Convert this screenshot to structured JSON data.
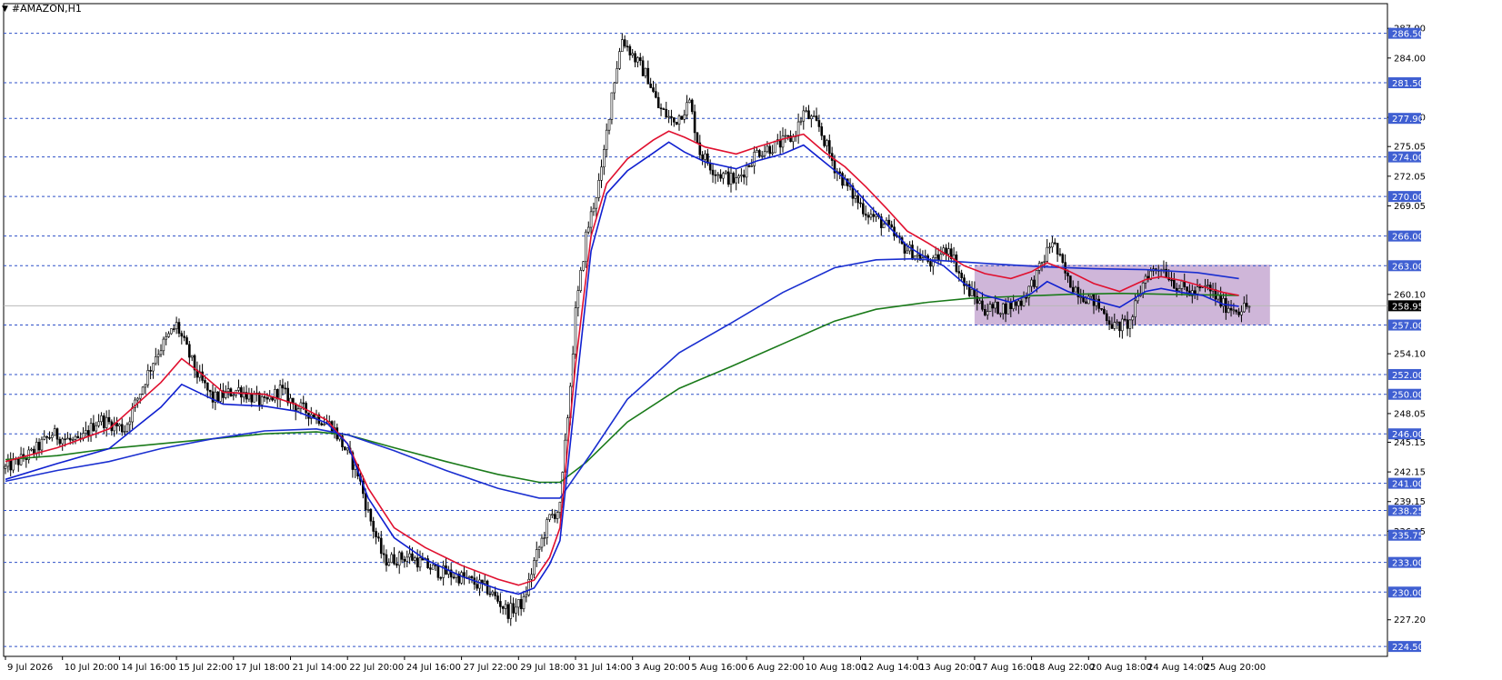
{
  "window": {
    "title": "#AMAZON,H1",
    "menu_icon": "triangle-down-icon"
  },
  "colors": {
    "level_line": "#2f50c8",
    "level_label_bg": "#3f5fd2",
    "ema_fast": "#e0102f",
    "ema_mid": "#1020d0",
    "ema_slow_blue": "#1a2fd0",
    "sma_green": "#1a7a1a",
    "range_box": "#c7a9d2",
    "price_tag_bg": "#000000"
  },
  "chart_data": {
    "type": "candlestick",
    "symbol": "#AMAZON",
    "timeframe": "H1",
    "ylim": [
      223.5,
      289.5
    ],
    "y_ticks": [
      "287.00",
      "284.00",
      "281.50",
      "278.00",
      "275.05",
      "272.05",
      "269.05",
      "266.00",
      "263.00",
      "260.10",
      "257.00",
      "254.10",
      "252.00",
      "250.00",
      "248.05",
      "246.00",
      "245.15",
      "242.15",
      "241.00",
      "239.15",
      "238.25",
      "236.15",
      "235.75",
      "233.00",
      "230.00",
      "227.20",
      "224.50"
    ],
    "levels": [
      286.5,
      281.5,
      277.9,
      274.0,
      270.0,
      266.0,
      263.0,
      257.0,
      252.0,
      250.0,
      246.0,
      241.0,
      238.25,
      235.75,
      233.0,
      230.0,
      224.5
    ],
    "level_labels": [
      "286.50",
      "281.50",
      "277.90",
      "274.00",
      "270.00",
      "266.00",
      "263.00",
      "257.00",
      "252.00",
      "250.00",
      "246.00",
      "241.00",
      "238.25",
      "235.75",
      "233.00",
      "230.00",
      "224.50"
    ],
    "current_price": 258.95,
    "current_price_label": "258.95",
    "x_labels": [
      "9 Jul 2026",
      "10 Jul 20:00",
      "14 Jul 16:00",
      "15 Jul 22:00",
      "17 Jul 18:00",
      "21 Jul 14:00",
      "22 Jul 20:00",
      "24 Jul 16:00",
      "27 Jul 22:00",
      "29 Jul 18:00",
      "31 Jul 14:00",
      "3 Aug 20:00",
      "5 Aug 16:00",
      "6 Aug 22:00",
      "10 Aug 18:00",
      "12 Aug 14:00",
      "13 Aug 20:00",
      "17 Aug 16:00",
      "18 Aug 22:00",
      "20 Aug 18:00",
      "24 Aug 14:00",
      "25 Aug 20:00"
    ],
    "x_label_index": [
      0,
      22,
      44,
      66,
      88,
      110,
      132,
      154,
      176,
      198,
      220,
      242,
      264,
      286,
      308,
      330,
      352,
      374,
      396,
      418,
      440,
      462
    ],
    "bar_count": 480,
    "path": [
      [
        0,
        242.5
      ],
      [
        10,
        244
      ],
      [
        18,
        246
      ],
      [
        28,
        245
      ],
      [
        36,
        247.5
      ],
      [
        46,
        246.5
      ],
      [
        58,
        254
      ],
      [
        66,
        257
      ],
      [
        74,
        252
      ],
      [
        80,
        249.5
      ],
      [
        90,
        250.5
      ],
      [
        100,
        249
      ],
      [
        106,
        250.5
      ],
      [
        112,
        248.8
      ],
      [
        120,
        247.8
      ],
      [
        126,
        246.8
      ],
      [
        132,
        244
      ],
      [
        136,
        242
      ],
      [
        140,
        238
      ],
      [
        146,
        233.2
      ],
      [
        156,
        233.6
      ],
      [
        166,
        232.2
      ],
      [
        176,
        231.5
      ],
      [
        186,
        230.3
      ],
      [
        194,
        228
      ],
      [
        200,
        229
      ],
      [
        204,
        233
      ],
      [
        210,
        237.5
      ],
      [
        214,
        238.5
      ],
      [
        218,
        251
      ],
      [
        220,
        258.2
      ],
      [
        222,
        262
      ],
      [
        224,
        266
      ],
      [
        230,
        272.4
      ],
      [
        234,
        280.5
      ],
      [
        238,
        286
      ],
      [
        244,
        283.5
      ],
      [
        248,
        282
      ],
      [
        252,
        279
      ],
      [
        258,
        277.5
      ],
      [
        264,
        279.5
      ],
      [
        268,
        274.5
      ],
      [
        274,
        272.5
      ],
      [
        282,
        271.5
      ],
      [
        290,
        274.5
      ],
      [
        298,
        275.2
      ],
      [
        304,
        276
      ],
      [
        308,
        278.5
      ],
      [
        314,
        277
      ],
      [
        320,
        273
      ],
      [
        326,
        270.5
      ],
      [
        332,
        268.5
      ],
      [
        340,
        267
      ],
      [
        346,
        265
      ],
      [
        352,
        264
      ],
      [
        358,
        263.2
      ],
      [
        364,
        265
      ],
      [
        370,
        261
      ],
      [
        378,
        258.6
      ],
      [
        386,
        258.8
      ],
      [
        392,
        259.4
      ],
      [
        398,
        262
      ],
      [
        404,
        265.6
      ],
      [
        410,
        261.5
      ],
      [
        416,
        260
      ],
      [
        420,
        259.4
      ],
      [
        424,
        258.2
      ],
      [
        428,
        256.8
      ],
      [
        434,
        257.2
      ],
      [
        440,
        262
      ],
      [
        446,
        263
      ],
      [
        452,
        261
      ],
      [
        458,
        260.2
      ],
      [
        464,
        260.8
      ],
      [
        470,
        259
      ],
      [
        476,
        258.6
      ],
      [
        480,
        258.95
      ]
    ],
    "ema_red": [
      [
        0,
        243.2
      ],
      [
        20,
        244.6
      ],
      [
        40,
        246.5
      ],
      [
        60,
        251.2
      ],
      [
        68,
        253.6
      ],
      [
        76,
        252
      ],
      [
        84,
        250.2
      ],
      [
        100,
        250
      ],
      [
        112,
        249
      ],
      [
        124,
        247.4
      ],
      [
        132,
        245
      ],
      [
        140,
        240.5
      ],
      [
        150,
        236.5
      ],
      [
        162,
        234.5
      ],
      [
        176,
        232.7
      ],
      [
        190,
        231.3
      ],
      [
        198,
        230.7
      ],
      [
        204,
        231.2
      ],
      [
        210,
        233.5
      ],
      [
        214,
        236.5
      ],
      [
        220,
        253
      ],
      [
        226,
        266
      ],
      [
        232,
        271.3
      ],
      [
        240,
        273.8
      ],
      [
        250,
        275.7
      ],
      [
        256,
        276.6
      ],
      [
        262,
        276
      ],
      [
        270,
        275
      ],
      [
        282,
        274.3
      ],
      [
        290,
        275
      ],
      [
        300,
        275.8
      ],
      [
        308,
        276.3
      ],
      [
        316,
        274.5
      ],
      [
        324,
        273
      ],
      [
        332,
        271
      ],
      [
        340,
        268.8
      ],
      [
        348,
        266.5
      ],
      [
        356,
        265.3
      ],
      [
        362,
        264.3
      ],
      [
        370,
        263
      ],
      [
        378,
        262.2
      ],
      [
        388,
        261.7
      ],
      [
        396,
        262.4
      ],
      [
        402,
        263.3
      ],
      [
        410,
        262.5
      ],
      [
        420,
        261.2
      ],
      [
        430,
        260.4
      ],
      [
        440,
        261.6
      ],
      [
        446,
        261.9
      ],
      [
        454,
        261.5
      ],
      [
        462,
        260.9
      ],
      [
        470,
        260.3
      ],
      [
        476,
        260
      ]
    ],
    "ema_blue_fast": [
      [
        0,
        241.4
      ],
      [
        20,
        243
      ],
      [
        40,
        244.5
      ],
      [
        60,
        248.7
      ],
      [
        68,
        251
      ],
      [
        76,
        250
      ],
      [
        84,
        249
      ],
      [
        100,
        248.8
      ],
      [
        112,
        248.3
      ],
      [
        124,
        247.1
      ],
      [
        132,
        245
      ],
      [
        140,
        239.5
      ],
      [
        150,
        235.5
      ],
      [
        162,
        233.3
      ],
      [
        176,
        231.6
      ],
      [
        190,
        230.3
      ],
      [
        198,
        229.8
      ],
      [
        204,
        230.4
      ],
      [
        210,
        232.8
      ],
      [
        214,
        235.2
      ],
      [
        220,
        250
      ],
      [
        226,
        264.5
      ],
      [
        232,
        270.3
      ],
      [
        240,
        272.6
      ],
      [
        250,
        274.4
      ],
      [
        256,
        275.5
      ],
      [
        262,
        274.5
      ],
      [
        270,
        273.5
      ],
      [
        282,
        272.8
      ],
      [
        290,
        273.6
      ],
      [
        300,
        274.3
      ],
      [
        308,
        275.2
      ],
      [
        316,
        273.5
      ],
      [
        324,
        271.8
      ],
      [
        332,
        269.5
      ],
      [
        340,
        267.2
      ],
      [
        348,
        265
      ],
      [
        356,
        263.7
      ],
      [
        362,
        263
      ],
      [
        370,
        261.2
      ],
      [
        378,
        260
      ],
      [
        388,
        259.3
      ],
      [
        396,
        260.2
      ],
      [
        402,
        261.4
      ],
      [
        410,
        260.4
      ],
      [
        420,
        259.5
      ],
      [
        430,
        258.8
      ],
      [
        440,
        260.4
      ],
      [
        446,
        260.7
      ],
      [
        454,
        260.3
      ],
      [
        462,
        260
      ],
      [
        470,
        259.1
      ],
      [
        476,
        258.9
      ]
    ],
    "ema_blue_slow": [
      [
        0,
        241.2
      ],
      [
        20,
        242.3
      ],
      [
        40,
        243.2
      ],
      [
        60,
        244.5
      ],
      [
        80,
        245.5
      ],
      [
        100,
        246.3
      ],
      [
        120,
        246.5
      ],
      [
        132,
        245.9
      ],
      [
        150,
        244.3
      ],
      [
        170,
        242.3
      ],
      [
        190,
        240.5
      ],
      [
        206,
        239.5
      ],
      [
        214,
        239.5
      ],
      [
        226,
        244
      ],
      [
        240,
        249.5
      ],
      [
        260,
        254.2
      ],
      [
        280,
        257.2
      ],
      [
        300,
        260.3
      ],
      [
        320,
        262.8
      ],
      [
        336,
        263.6
      ],
      [
        350,
        263.7
      ],
      [
        362,
        263.5
      ],
      [
        380,
        263.2
      ],
      [
        400,
        262.9
      ],
      [
        420,
        262.7
      ],
      [
        440,
        262.6
      ],
      [
        460,
        262.3
      ],
      [
        476,
        261.7
      ]
    ],
    "sma_green": [
      [
        0,
        243.4
      ],
      [
        20,
        243.8
      ],
      [
        40,
        244.5
      ],
      [
        60,
        245
      ],
      [
        80,
        245.5
      ],
      [
        100,
        246
      ],
      [
        120,
        246.2
      ],
      [
        132,
        245.9
      ],
      [
        150,
        244.6
      ],
      [
        170,
        243.2
      ],
      [
        190,
        241.9
      ],
      [
        206,
        241.1
      ],
      [
        214,
        241.1
      ],
      [
        224,
        243.1
      ],
      [
        240,
        247.2
      ],
      [
        260,
        250.6
      ],
      [
        280,
        252.8
      ],
      [
        300,
        255.1
      ],
      [
        320,
        257.4
      ],
      [
        336,
        258.6
      ],
      [
        356,
        259.3
      ],
      [
        372,
        259.7
      ],
      [
        390,
        259.9
      ],
      [
        410,
        260.1
      ],
      [
        430,
        260.2
      ],
      [
        450,
        260.1
      ],
      [
        476,
        260
      ]
    ],
    "range_box": {
      "x0": 374,
      "x1": 488,
      "y_top": 263.1,
      "y_bottom": 257.0
    }
  }
}
